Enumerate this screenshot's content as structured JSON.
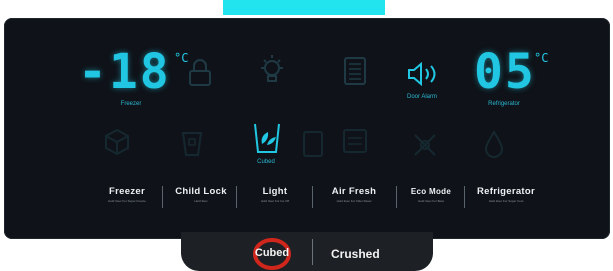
{
  "banner": {
    "text": ""
  },
  "display": {
    "freezer": {
      "temp": "-18",
      "unit": "°C",
      "label": "Freezer"
    },
    "refrigerator": {
      "temp": "05",
      "unit": "°C",
      "label": "Refrigerator"
    },
    "door_alarm_label": "Door Alarm",
    "cubed_label": "Cubed"
  },
  "buttons": [
    {
      "label": "Freezer",
      "sub": "Hold 3sec For Super Freeze"
    },
    {
      "label": "Child Lock",
      "sub": "Hold 3sec"
    },
    {
      "label": "Light",
      "sub": "Hold 3sec For Ice Off"
    },
    {
      "label": "Air Fresh",
      "sub": "Hold 3sec For Filter Reset"
    },
    {
      "label": "Eco Mode",
      "sub": "Hold 3sec For Beta"
    },
    {
      "label": "Refrigerator",
      "sub": "Hold 3sec For Super Cool"
    }
  ],
  "ice_options": {
    "cubed": "Cubed",
    "crushed": "Crushed"
  },
  "colors": {
    "accent": "#21c7e2",
    "panel": "#0f1319",
    "highlight_ring": "#d0261c"
  }
}
